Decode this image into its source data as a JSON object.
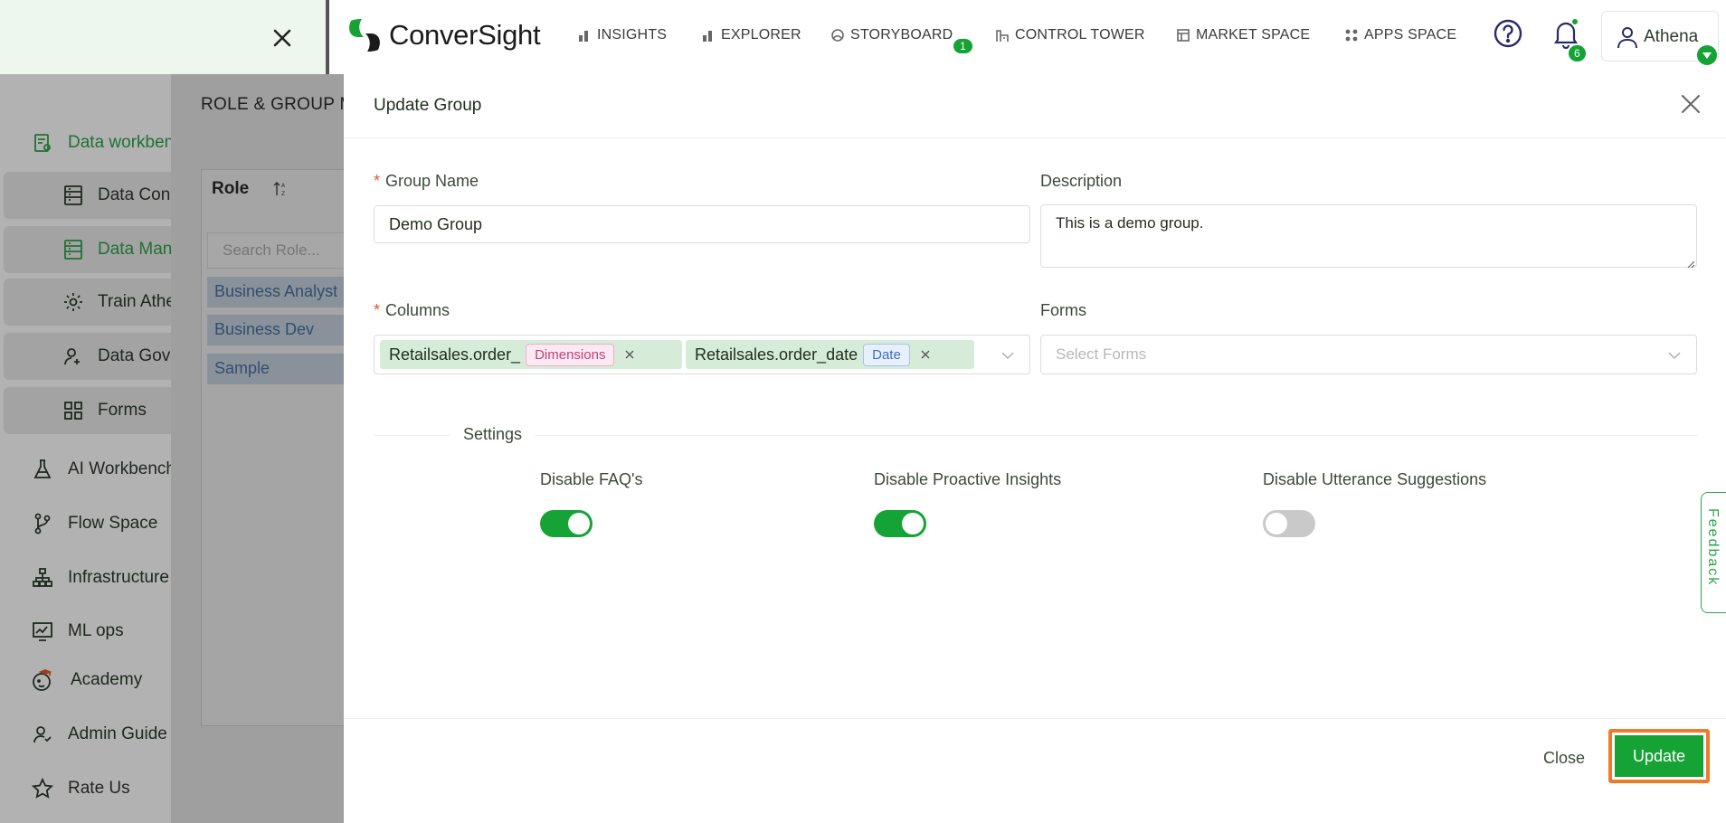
{
  "sidebar": {
    "items": [
      {
        "label": "Data workbench",
        "icon": "data-workbench-icon"
      },
      {
        "label": "Data Connectors",
        "icon": "data-connectors-icon"
      },
      {
        "label": "Data Management",
        "icon": "data-management-icon"
      },
      {
        "label": "Train Athena",
        "icon": "gear-icon"
      },
      {
        "label": "Data Governance",
        "icon": "data-governance-icon"
      },
      {
        "label": "Forms",
        "icon": "forms-grid-icon"
      },
      {
        "label": "AI Workbench",
        "icon": "flask-icon"
      },
      {
        "label": "Flow Space",
        "icon": "flow-branch-icon"
      },
      {
        "label": "Infrastructure",
        "icon": "infrastructure-icon"
      },
      {
        "label": "ML ops",
        "icon": "ml-ops-chart-icon"
      },
      {
        "label": "Academy",
        "icon": "academy-icon"
      },
      {
        "label": "Admin Guide",
        "icon": "admin-guide-icon"
      },
      {
        "label": "Rate Us",
        "icon": "star-icon"
      }
    ]
  },
  "header": {
    "logo_text": "ConverSight",
    "nav": [
      {
        "label": "INSIGHTS",
        "icon": "bar-chart-icon"
      },
      {
        "label": "EXPLORER",
        "icon": "bar-chart-icon"
      },
      {
        "label": "STORYBOARD",
        "icon": "storyboard-icon",
        "badge": "1"
      },
      {
        "label": "CONTROL TOWER",
        "icon": "control-tower-icon"
      },
      {
        "label": "MARKET SPACE",
        "icon": "market-space-icon"
      },
      {
        "label": "APPS SPACE",
        "icon": "apps-grid-icon"
      }
    ],
    "notifications_count": "6",
    "user_name": "Athena"
  },
  "background_panel": {
    "title": "ROLE & GROUP MANAGEMENT",
    "role_header": "Role",
    "search_placeholder": "Search Role...",
    "roles": [
      "Business Analyst",
      "Business Dev",
      "Sample"
    ]
  },
  "drawer": {
    "title": "Update Group",
    "group_name_label": "Group Name",
    "group_name_value": "Demo Group",
    "description_label": "Description",
    "description_value": "This is a demo group.",
    "columns_label": "Columns",
    "columns": [
      {
        "name": "Retailsales.order_",
        "tag": "Dimensions"
      },
      {
        "name": "Retailsales.order_date",
        "tag": "Date"
      }
    ],
    "forms_label": "Forms",
    "forms_placeholder": "Select Forms",
    "settings_title": "Settings",
    "toggles": [
      {
        "label": "Disable FAQ's",
        "on": true
      },
      {
        "label": "Disable Proactive Insights",
        "on": true
      },
      {
        "label": "Disable Utterance Suggestions",
        "on": false
      }
    ],
    "close_label": "Close",
    "update_label": "Update"
  },
  "feedback_label": "Feedback",
  "colors": {
    "brand_green": "#15a336",
    "highlight_orange": "#f07a2c"
  }
}
